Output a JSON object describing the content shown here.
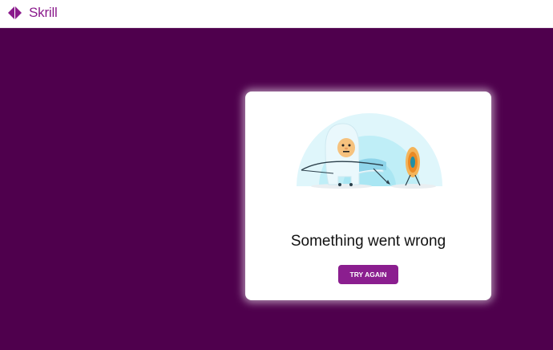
{
  "header": {
    "brand": "Skrill",
    "brand_color": "#8a1a8c",
    "logo_icon": "skrill-double-arrow-icon"
  },
  "error_card": {
    "illustration": "yeti-archer-illustration",
    "title": "Something went wrong",
    "button_label": "TRY AGAIN",
    "button_color": "#8b1e8f"
  },
  "colors": {
    "background": "#4f004d",
    "topbar": "#ffffff",
    "card": "#ffffff"
  }
}
